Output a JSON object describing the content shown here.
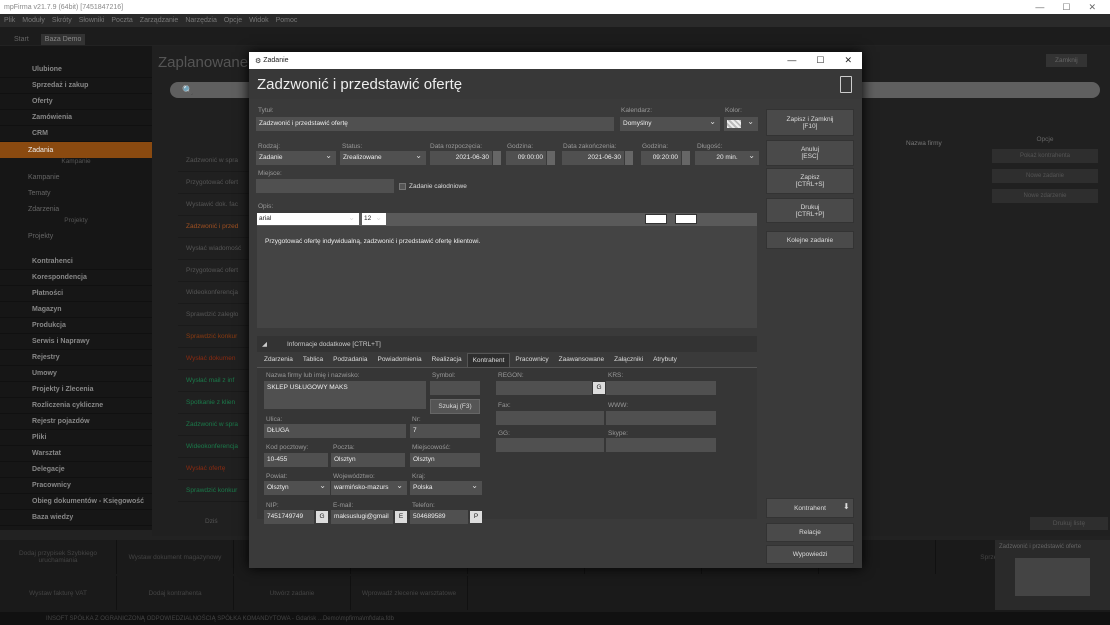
{
  "app": {
    "title": "mpFirma v21.7.9 (64bit) [7451847216]"
  },
  "menu": [
    "Plik",
    "Moduły",
    "Skróty",
    "Słowniki",
    "Poczta",
    "Zarządzanie",
    "Narzędzia",
    "Opcje",
    "Widok",
    "Pomoc"
  ],
  "tabs": [
    "Start",
    "Baza Demo"
  ],
  "sidebar": {
    "items": [
      "Ulubione",
      "Sprzedaż i zakup",
      "Oferty",
      "Zamówienia",
      "CRM"
    ],
    "selected": "Zadania",
    "kampanie_hdr": "Kampanie",
    "kampanie": [
      "Kampanie",
      "Tematy",
      "Zdarzenia"
    ],
    "projekty_hdr": "Projekty",
    "projekty": [
      "Projekty"
    ],
    "items2": [
      "Kontrahenci",
      "Korespondencja",
      "Płatności",
      "Magazyn",
      "Produkcja",
      "Serwis i Naprawy",
      "Rejestry",
      "Umowy",
      "Projekty i Zlecenia",
      "Rozliczenia cykliczne",
      "Rejestr pojazdów",
      "Pliki",
      "Warsztat",
      "Delegacje",
      "Pracownicy",
      "Obieg dokumentów - Księgowość",
      "Baza wiedzy"
    ]
  },
  "bg": {
    "title": "Zaplanowane",
    "zamknij": "Zamknij",
    "tasks": [
      "Zadzwonić w spra",
      "Przygotować ofert",
      "Wystawić dok. fac",
      "Zadzwonić i przed",
      "Wysłać wiadomość",
      "Przygotować ofert",
      "Wideokonferencja",
      "Sprawdzić zaległo",
      "Sprawdzić konkur",
      "Wysłać dokumen",
      "Wysłać mail z inf",
      "Spotkanie z klien",
      "Zadzwonić w spra",
      "Wideokonferencja",
      "Wysłać ofertę",
      "Sprawdzić konkur"
    ],
    "opcje": "Opcje",
    "right_buttons": [
      "Pokaż kontrahenta",
      "Nowe zadanie",
      "Nowe zdarzenie"
    ],
    "nazwa_firmy": "Nazwa firmy",
    "drukuj_liste": "Drukuj listę",
    "dzis": "Dziś",
    "bottom": [
      "Dodaj przypisek Szybkiego uruchamiania",
      "Wystaw dokument magazynowy",
      "",
      "",
      "",
      "",
      "",
      "",
      "Sprzedaż",
      "Wystaw fakturę VAT",
      "Dodaj kontrahenta",
      "Utwórz zadanie",
      "Wprowadź zlecenie warsztatowe",
      "",
      ""
    ],
    "thumb_title": "Zadzwonić i przedstawić oferte",
    "status": "INSOFT SPÓŁKA Z OGRANICZONĄ ODPOWIEDZIALNOŚCIĄ SPÓŁKA KOMANDYTOWA - Gdańsk ...Demo\\mpfirma\\mf\\data.fdb"
  },
  "dialog": {
    "window_title": "Zadanie",
    "heading": "Zadzwonić i przedstawić ofertę",
    "tytul_label": "Tytuł:",
    "tytul": "Zadzwonić i przedstawić ofertę",
    "kalendarz_label": "Kalendarz:",
    "kalendarz": "Domyślny",
    "kolor_label": "Kolor:",
    "rodzaj_label": "Rodzaj:",
    "rodzaj": "Zadanie",
    "status_label": "Status:",
    "status": "Zrealizowane",
    "data_rozp_label": "Data rozpoczęcia:",
    "data_rozp": "2021-06-30",
    "godzina_label": "Godzina:",
    "godzina_rozp": "09:00:00",
    "data_zak_label": "Data zakończenia:",
    "data_zak": "2021-06-30",
    "godzina_zak": "09:20:00",
    "dlugosc_label": "Długość:",
    "dlugosc": "20 min.",
    "miejsce_label": "Miejsce:",
    "calodniowe": "Zadanie całodniowe",
    "opis_label": "Opis:",
    "font": "arial",
    "font_size": "12",
    "opis": "Przygotować ofertę indywidualną, zadzwonić i przedstawić ofertę klientowi.",
    "btn_zapisz_zamknij": "Zapisz i Zamknij",
    "btn_zapisz_zamknij_k": "[F10]",
    "btn_anuluj": "Anuluj",
    "btn_anuluj_k": "[ESC]",
    "btn_zapisz": "Zapisz",
    "btn_zapisz_k": "[CTRL+S]",
    "btn_drukuj": "Drukuj",
    "btn_drukuj_k": "[CTRL+P]",
    "btn_kolejne": "Kolejne zadanie",
    "btn_kontrahent": "Kontrahent",
    "btn_relacje": "Relacje",
    "btn_wypowiedzi": "Wypowiedzi",
    "info": "Informacje dodatkowe [CTRL+T]",
    "tabs": [
      "Zdarzenia",
      "Tablica",
      "Podzadania",
      "Powiadomienia",
      "Realizacja",
      "Kontrahent",
      "Pracownicy",
      "Zaawansowane",
      "Załączniki",
      "Atrybuty"
    ],
    "active_tab": "Kontrahent",
    "k": {
      "nazwa_label": "Nazwa firmy lub imię i nazwisko:",
      "nazwa": "SKLEP USŁUGOWY MAKS",
      "symbol_label": "Symbol:",
      "szukaj": "Szukaj (F3)",
      "regon_label": "REGON:",
      "krs_label": "KRS:",
      "fax_label": "Fax:",
      "www_label": "WWW:",
      "ulica_label": "Ulica:",
      "ulica": "DŁUGA",
      "nr_label": "Nr:",
      "nr": "7",
      "gg_label": "GG:",
      "skype_label": "Skype:",
      "kod_label": "Kod pocztowy:",
      "kod": "10-455",
      "poczta_label": "Poczta:",
      "poczta": "Olsztyn",
      "miejsc_label": "Miejscowość:",
      "miejsc": "Olsztyn",
      "powiat_label": "Powiat:",
      "powiat": "Olsztyn",
      "woj_label": "Województwo:",
      "woj": "warmińsko-mazurs",
      "kraj_label": "Kraj:",
      "kraj": "Polska",
      "nip_label": "NIP:",
      "nip": "7451749749",
      "email_label": "E-mail:",
      "email": "maksuslugi@gmail",
      "tel_label": "Telefon:",
      "tel": "504689589"
    }
  }
}
